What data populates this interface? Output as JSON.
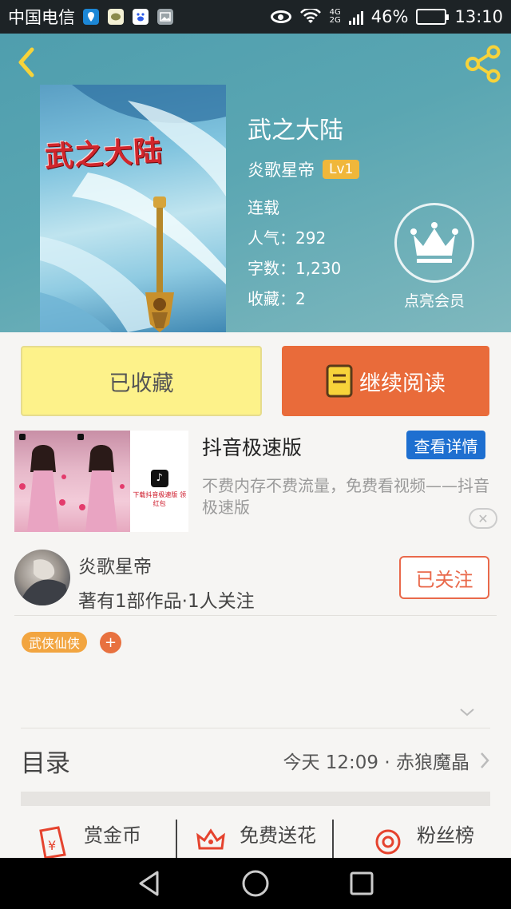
{
  "status_bar": {
    "carrier": "中国电信",
    "network_top": "4G",
    "network_bottom": "2G",
    "battery": "46%",
    "time": "13:10",
    "battery_level": 0.46,
    "icons": [
      "location-icon",
      "wechat-icon",
      "baidu-icon",
      "gallery-icon",
      "eye-icon",
      "wifi-icon",
      "signal-icon",
      "battery-icon"
    ]
  },
  "book": {
    "cover_title": "武之大陆",
    "title": "武之大陆",
    "author": "炎歌星帝",
    "level": "Lv1",
    "status": "连载",
    "popularity": "人气：292",
    "word_count": "字数：1,230",
    "favorites": "收藏：2"
  },
  "member": {
    "label": "点亮会员"
  },
  "actions": {
    "collected": "已收藏",
    "continue_reading": "继续阅读"
  },
  "ad": {
    "title": "抖音极速版",
    "detail_button": "查看详情",
    "description": "不费内存不费流量，免费看视频——抖音极速版",
    "thumb_text": "下载抖音极速版 领红包",
    "close": "✕"
  },
  "author_card": {
    "name": "炎歌星帝",
    "stats": "著有1部作品·1人关注",
    "follow_button": "已关注"
  },
  "tags": [
    "武侠仙侠"
  ],
  "tag_add": "+",
  "toc": {
    "label": "目录",
    "latest": "今天 12:09 · 赤狼魔晶"
  },
  "bottom_actions": [
    {
      "label": "赏金币"
    },
    {
      "label": "免费送花"
    },
    {
      "label": "粉丝榜"
    }
  ],
  "colors": {
    "accent_orange": "#e96b3a",
    "collected_yellow": "#fdf28a",
    "ad_blue": "#1e6fd0",
    "tag_orange": "#f2a540",
    "header_teal": "#5aa6b2"
  }
}
